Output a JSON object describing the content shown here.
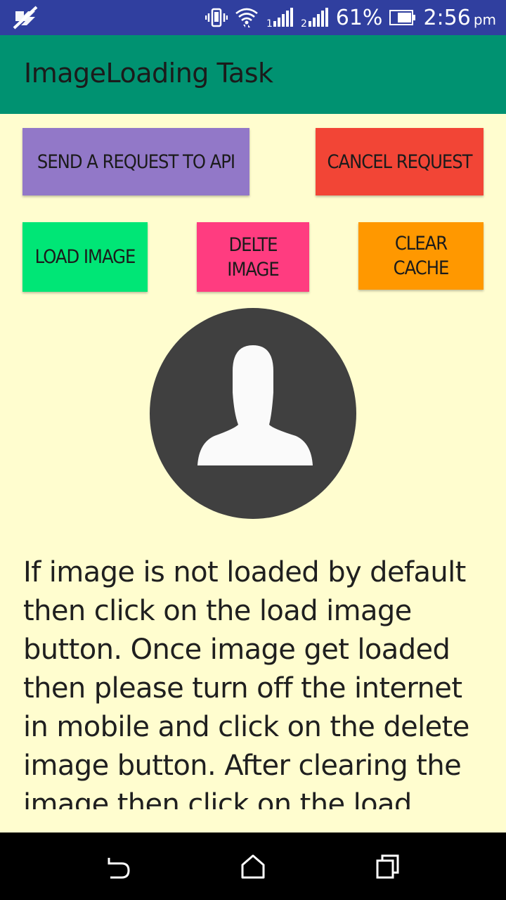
{
  "status_bar": {
    "battery_percent": "61%",
    "time": "2:56",
    "ampm": "pm",
    "icons": [
      "no-sim-or-bluetooth-icon",
      "vibrate-icon",
      "wifi-icon",
      "signal-1-icon",
      "signal-2-icon",
      "battery-icon"
    ]
  },
  "app_bar": {
    "title": "ImageLoading Task"
  },
  "buttons": {
    "send": "SEND A REQUEST TO API",
    "cancel": "CANCEL REQUEST",
    "load": "LOAD IMAGE",
    "delete": "DELTE\nIMAGE",
    "clear": "CLEAR\nCACHE"
  },
  "colors": {
    "status_bar": "#303f9f",
    "app_bar": "#009271",
    "background": "#fffdcf",
    "send": "#9278c8",
    "cancel": "#f24536",
    "load": "#00e676",
    "delete": "#ff3c80",
    "clear": "#ff9800"
  },
  "instructions": "If image is not loaded by default then click on the load image button. Once image get loaded then please turn off the internet in mobile and click on the delete image button. After clearing the image then click on the load",
  "nav_bar": {
    "icons": [
      "back-icon",
      "home-icon",
      "recent-apps-icon"
    ]
  }
}
